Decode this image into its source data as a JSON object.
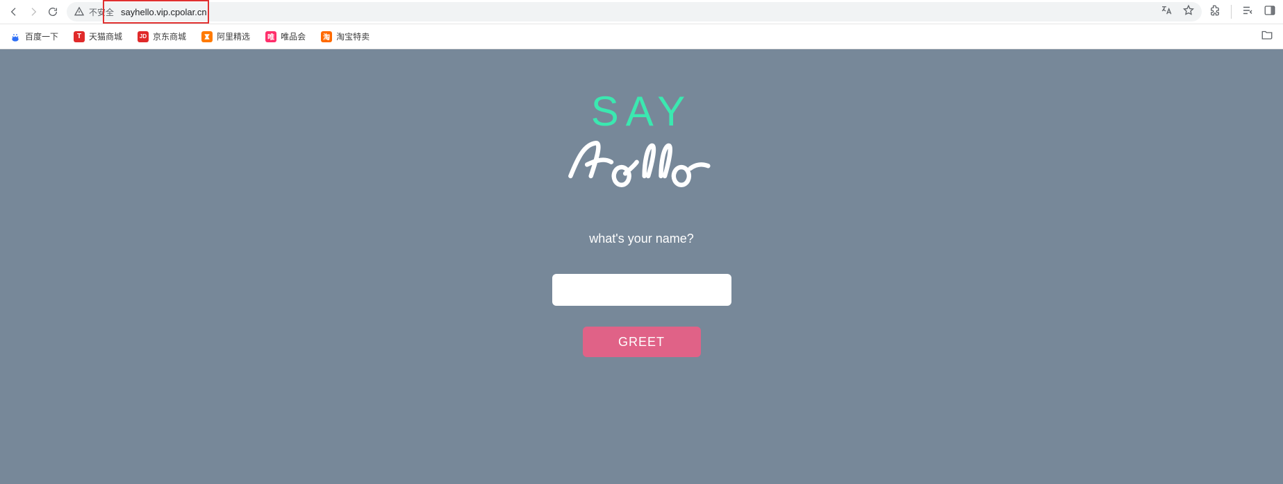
{
  "browser": {
    "security_label": "不安全",
    "url": "sayhello.vip.cpolar.cn"
  },
  "bookmarks": {
    "items": [
      {
        "label": "百度一下",
        "bg": "#2e6ff5",
        "txt": ""
      },
      {
        "label": "天猫商城",
        "bg": "#e02a2a",
        "txt": "T"
      },
      {
        "label": "京东商城",
        "bg": "#e02a2a",
        "txt": "JD"
      },
      {
        "label": "阿里精选",
        "bg": "#ff7a00",
        "txt": ""
      },
      {
        "label": "唯品会",
        "bg": "#ff2f6b",
        "txt": "唯"
      },
      {
        "label": "淘宝特卖",
        "bg": "#ff6a00",
        "txt": "淘"
      }
    ]
  },
  "page": {
    "title_top": "SAY",
    "prompt": "what's your name?",
    "name_value": "",
    "button_label": "GREET"
  },
  "colors": {
    "page_bg": "#778899",
    "accent_mint": "#3be8b0",
    "button_pink": "#e06287",
    "highlight_red": "#e03030"
  }
}
